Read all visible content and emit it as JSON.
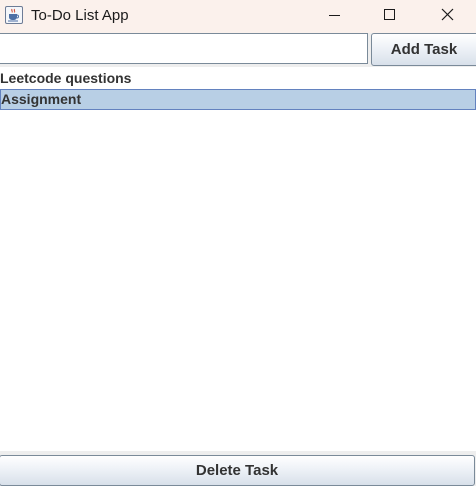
{
  "window": {
    "title": "To-Do List App",
    "icon": "java-cup-icon",
    "controls": [
      "minimize-icon",
      "maximize-icon",
      "close-icon"
    ],
    "titlebar_color": "#fbf1ec"
  },
  "input": {
    "value": "",
    "placeholder": ""
  },
  "toolbar": {
    "add_label": "Add Task",
    "delete_label": "Delete Task"
  },
  "tasks": [
    {
      "label": "Leetcode questions",
      "selected": false
    },
    {
      "label": "Assignment",
      "selected": true
    }
  ],
  "colors": {
    "selection_background": "#b8cfe5",
    "selection_border": "#6382bf",
    "button_border": "#7a8a99"
  }
}
